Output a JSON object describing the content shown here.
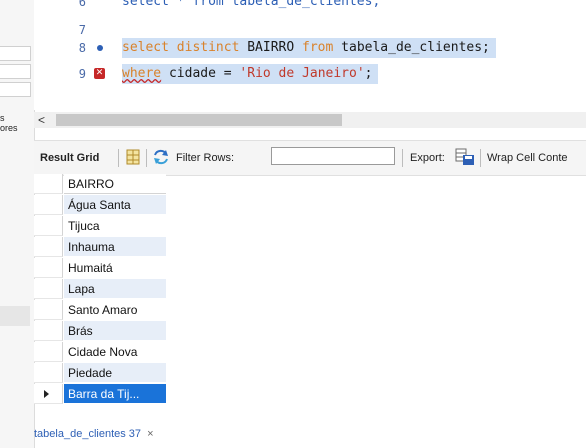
{
  "left_panel": {
    "partial_text_1": "s",
    "partial_text_2": "ores"
  },
  "editor": {
    "lines": [
      {
        "number": "6",
        "code_prefix": "select * from tabela_de_clientes;"
      },
      {
        "number": "7"
      },
      {
        "number": "8",
        "kw1": "select distinct",
        "mid": " BAIRRO ",
        "kw2": "from",
        "tail": " tabela_de_clientes;"
      },
      {
        "number": "9",
        "kw1": "where",
        "mid": " cidade = ",
        "str": "'Rio de Janeiro'",
        "tail": ";"
      }
    ]
  },
  "result_toolbar": {
    "result_grid_label": "Result Grid",
    "filter_rows_label": "Filter Rows:",
    "filter_value": "",
    "export_label": "Export:",
    "wrap_label": "Wrap Cell Conte"
  },
  "grid": {
    "column_header": "BAIRRO",
    "rows": [
      "Água Santa",
      "Tijuca",
      "Inhauma",
      "Humaitá",
      "Lapa",
      "Santo Amaro",
      "Brás",
      "Cidade Nova",
      "Piedade",
      "Barra da Tij..."
    ]
  },
  "bottom_tab": {
    "label": "tabela_de_clientes 37",
    "close": "×"
  },
  "icons": {
    "scroll_left": "<"
  }
}
